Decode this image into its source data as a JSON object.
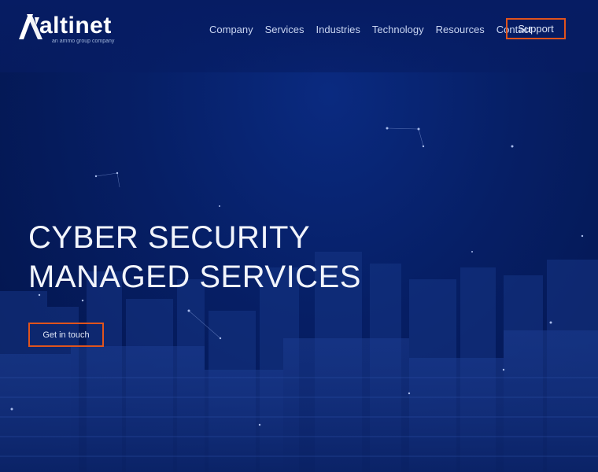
{
  "brand": {
    "name": "altinet",
    "tagline": "an ammo group company"
  },
  "nav": {
    "items": [
      "Company",
      "Services",
      "Industries",
      "Technology",
      "Resources",
      "Contact"
    ],
    "support_label": "Support"
  },
  "hero": {
    "headline_line1": "CYBER SECURITY",
    "headline_line2": "MANAGED SERVICES",
    "cta_label": "Get in touch"
  },
  "colors": {
    "background": "#041a52",
    "accent": "#e0541c",
    "text": "#f2f5fc"
  }
}
